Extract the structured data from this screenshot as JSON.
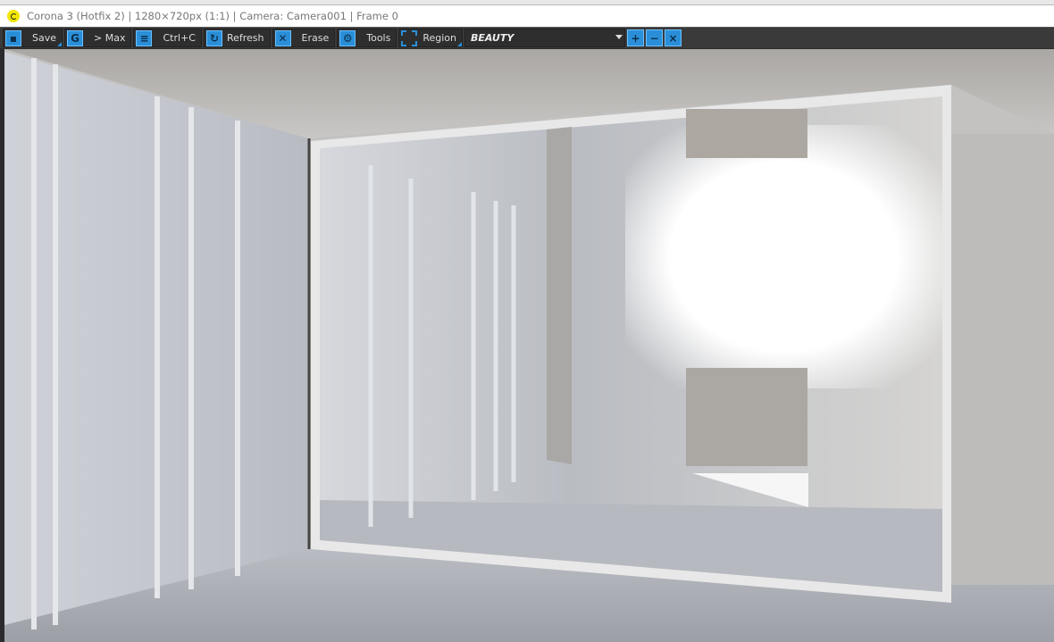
{
  "window": {
    "title": "Corona 3 (Hotfix 2) | 1280×720px (1:1) | Camera: Camera001 | Frame 0"
  },
  "toolbar": {
    "save": "Save",
    "max": "> Max",
    "copy": "Ctrl+C",
    "refresh": "Refresh",
    "erase": "Erase",
    "tools": "Tools",
    "region": "Region",
    "render_element": "BEAUTY"
  },
  "colors": {
    "accent": "#2a8fd8",
    "toolbar_bg": "#3a3a3a"
  }
}
